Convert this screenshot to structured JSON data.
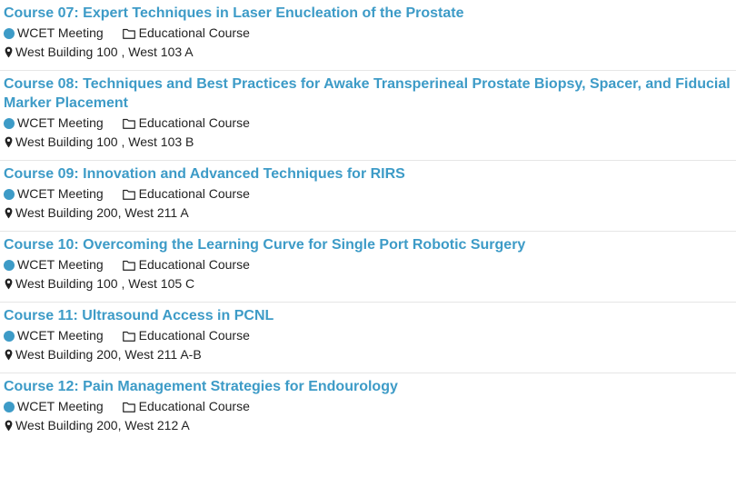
{
  "colors": {
    "title_link": "#3d9bc7",
    "track_dot": "#3d9bc7",
    "text": "#222222",
    "divider": "#e6e6e6"
  },
  "icons": {
    "track": "dot-icon",
    "type": "folder-icon",
    "location": "map-pin-icon"
  },
  "sessions": [
    {
      "title": "Course 07: Expert Techniques in Laser Enucleation of the Prostate",
      "track": "WCET Meeting",
      "type": "Educational Course",
      "location": "West Building 100 , West 103 A"
    },
    {
      "title": "Course 08: Techniques and Best Practices for Awake Transperineal Prostate Biopsy, Spacer, and Fiducial Marker Placement",
      "track": "WCET Meeting",
      "type": "Educational Course",
      "location": "West Building 100 , West 103 B"
    },
    {
      "title": "Course 09: Innovation and Advanced Techniques for RIRS",
      "track": "WCET Meeting",
      "type": "Educational Course",
      "location": "West Building 200, West 211 A"
    },
    {
      "title": "Course 10: Overcoming the Learning Curve for Single Port Robotic Surgery",
      "track": "WCET Meeting",
      "type": "Educational Course",
      "location": "West Building 100 , West 105 C"
    },
    {
      "title": "Course 11: Ultrasound Access in PCNL",
      "track": "WCET Meeting",
      "type": "Educational Course",
      "location": "West Building 200, West 211 A-B"
    },
    {
      "title": "Course 12: Pain Management Strategies for Endourology",
      "track": "WCET Meeting",
      "type": "Educational Course",
      "location": "West Building 200, West 212 A"
    }
  ]
}
